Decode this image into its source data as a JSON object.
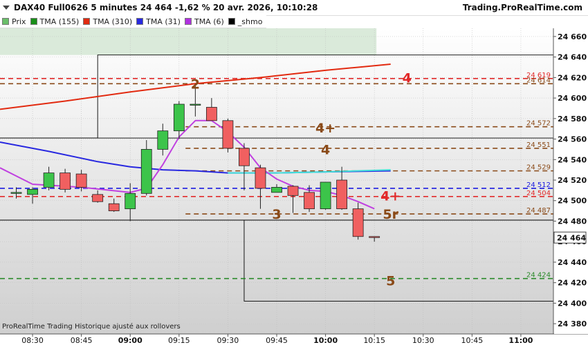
{
  "header": {
    "title": "DAX40 Full0626 5 minutes 24 464 -1,62 % 20 avr. 2026, 10:10:28",
    "brand": "Trading.ProRealTime.com"
  },
  "legend": [
    {
      "label": "Prix",
      "color": "#6abf69"
    },
    {
      "label": "TMA (155)",
      "color": "#1a8f1a"
    },
    {
      "label": "TMA (310)",
      "color": "#e22a10"
    },
    {
      "label": "TMA (31)",
      "color": "#2828e0"
    },
    {
      "label": "TMA (6)",
      "color": "#b030e0"
    },
    {
      "label": "_shmo",
      "color": "#000000"
    }
  ],
  "footer": "ProRealTime Trading  Historique ajusté aux rollovers",
  "colors": {
    "up": "#3cc44a",
    "down": "#f06060",
    "tma310": "#e22a10",
    "tma31": "#2828e0",
    "tma6": "#c040e0",
    "tma155": "#40e0d8",
    "brown": "#8a4a18",
    "red_level": "#e22a2a",
    "green_level": "#2a8a2a",
    "blue_level": "#1a1ae0"
  },
  "chart_data": {
    "type": "candlestick",
    "x_axis": {
      "ticks": [
        "08:30",
        "08:45",
        "09:00",
        "09:15",
        "09:30",
        "09:45",
        "10:00",
        "10:15",
        "10:30",
        "10:45",
        "11:00"
      ],
      "bold_ticks": [
        "09:00",
        "10:00",
        "11:00"
      ],
      "range": [
        "08:20",
        "11:10"
      ]
    },
    "y_axis": {
      "min": 24370,
      "max": 24668,
      "ticks": [
        24380,
        24400,
        24420,
        24440,
        24460,
        24480,
        24500,
        24520,
        24540,
        24560,
        24580,
        24600,
        24620,
        24640,
        24660
      ],
      "current_price": 24464
    },
    "candles": [
      {
        "t": "08:25",
        "o": 24508,
        "h": 24513,
        "l": 24502,
        "c": 24508
      },
      {
        "t": "08:30",
        "o": 24506,
        "h": 24513,
        "l": 24497,
        "c": 24511
      },
      {
        "t": "08:35",
        "o": 24513,
        "h": 24533,
        "l": 24510,
        "c": 24527
      },
      {
        "t": "08:40",
        "o": 24527,
        "h": 24531,
        "l": 24508,
        "c": 24511
      },
      {
        "t": "08:45",
        "o": 24526,
        "h": 24530,
        "l": 24509,
        "c": 24513
      },
      {
        "t": "08:50",
        "o": 24506,
        "h": 24510,
        "l": 24498,
        "c": 24499
      },
      {
        "t": "08:55",
        "o": 24497,
        "h": 24502,
        "l": 24489,
        "c": 24490
      },
      {
        "t": "09:00",
        "o": 24492,
        "h": 24517,
        "l": 24480,
        "c": 24507
      },
      {
        "t": "09:05",
        "o": 24507,
        "h": 24559,
        "l": 24505,
        "c": 24550
      },
      {
        "t": "09:10",
        "o": 24550,
        "h": 24575,
        "l": 24544,
        "c": 24568
      },
      {
        "t": "09:15",
        "o": 24568,
        "h": 24597,
        "l": 24560,
        "c": 24594
      },
      {
        "t": "09:20",
        "o": 24594,
        "h": 24614,
        "l": 24582,
        "c": 24594
      },
      {
        "t": "09:25",
        "o": 24591,
        "h": 24600,
        "l": 24578,
        "c": 24578
      },
      {
        "t": "09:30",
        "o": 24578,
        "h": 24580,
        "l": 24547,
        "c": 24551
      },
      {
        "t": "09:35",
        "o": 24551,
        "h": 24556,
        "l": 24510,
        "c": 24534
      },
      {
        "t": "09:40",
        "o": 24532,
        "h": 24535,
        "l": 24492,
        "c": 24512
      },
      {
        "t": "09:45",
        "o": 24508,
        "h": 24516,
        "l": 24510,
        "c": 24513
      },
      {
        "t": "09:50",
        "o": 24514,
        "h": 24515,
        "l": 24488,
        "c": 24505
      },
      {
        "t": "09:55",
        "o": 24508,
        "h": 24515,
        "l": 24489,
        "c": 24492
      },
      {
        "t": "10:00",
        "o": 24492,
        "h": 24518,
        "l": 24491,
        "c": 24518
      },
      {
        "t": "10:05",
        "o": 24520,
        "h": 24533,
        "l": 24491,
        "c": 24492
      },
      {
        "t": "10:10",
        "o": 24492,
        "h": 24498,
        "l": 24462,
        "c": 24465
      },
      {
        "t": "10:15",
        "o": 24465,
        "h": 24464,
        "l": 24460,
        "c": 24464
      }
    ],
    "series": [
      {
        "name": "TMA (310)",
        "color": "#e22a10",
        "x": [
          "08:20",
          "08:40",
          "09:00",
          "09:20",
          "09:40",
          "10:00",
          "10:10",
          "10:20"
        ],
        "y": [
          24589,
          24597,
          24606,
          24614,
          24620,
          24627,
          24630,
          24633
        ]
      },
      {
        "name": "TMA (31)",
        "color": "#2828e0",
        "x": [
          "08:20",
          "08:35",
          "08:50",
          "09:00",
          "09:10",
          "09:20",
          "09:30",
          "09:45",
          "10:00",
          "10:20"
        ],
        "y": [
          24557,
          24548,
          24538,
          24533,
          24530,
          24529,
          24527,
          24527,
          24528,
          24529
        ]
      },
      {
        "name": "TMA (155)",
        "color": "#40e0d8",
        "x": [
          "09:30",
          "09:45",
          "10:00",
          "10:20"
        ],
        "y": [
          24527,
          24527,
          24528,
          24530
        ]
      },
      {
        "name": "TMA (6)",
        "color": "#c040e0",
        "x": [
          "08:20",
          "08:30",
          "08:45",
          "09:00",
          "09:05",
          "09:10",
          "09:15",
          "09:20",
          "09:25",
          "09:30",
          "09:35",
          "09:40",
          "09:45",
          "09:50",
          "09:55",
          "10:00",
          "10:05",
          "10:10",
          "10:15"
        ],
        "y": [
          24532,
          24516,
          24513,
          24508,
          24512,
          24535,
          24562,
          24578,
          24578,
          24567,
          24552,
          24532,
          24521,
          24514,
          24510,
          24509,
          24505,
          24499,
          24492
        ]
      }
    ],
    "levels": [
      {
        "value": 24619,
        "label": "24 619",
        "style": "red"
      },
      {
        "value": 24614,
        "label": "24 614",
        "style": "brown"
      },
      {
        "value": 24572,
        "label": "24 572",
        "style": "brown"
      },
      {
        "value": 24551,
        "label": "24 551",
        "style": "brown"
      },
      {
        "value": 24529,
        "label": "24 529",
        "style": "brown"
      },
      {
        "value": 24512,
        "label": "24 512",
        "style": "blue"
      },
      {
        "value": 24504,
        "label": "24 504",
        "style": "red"
      },
      {
        "value": 24487,
        "label": "24 487",
        "style": "brown"
      },
      {
        "value": 24424,
        "label": "24 424",
        "style": "green"
      }
    ],
    "annotations": [
      {
        "text": "2",
        "t": "09:20",
        "y": 24614,
        "color": "brown"
      },
      {
        "text": "4",
        "t": "10:25",
        "y": 24620,
        "color": "red"
      },
      {
        "text": "4+",
        "t": "10:00",
        "y": 24571,
        "color": "brown"
      },
      {
        "text": "4",
        "t": "10:00",
        "y": 24550,
        "color": "brown"
      },
      {
        "text": "4+",
        "t": "10:20",
        "y": 24505,
        "color": "red"
      },
      {
        "text": "3",
        "t": "09:45",
        "y": 24487,
        "color": "brown"
      },
      {
        "text": "5r",
        "t": "10:20",
        "y": 24487,
        "color": "brown"
      },
      {
        "text": "5",
        "t": "10:20",
        "y": 24422,
        "color": "brown"
      }
    ]
  }
}
